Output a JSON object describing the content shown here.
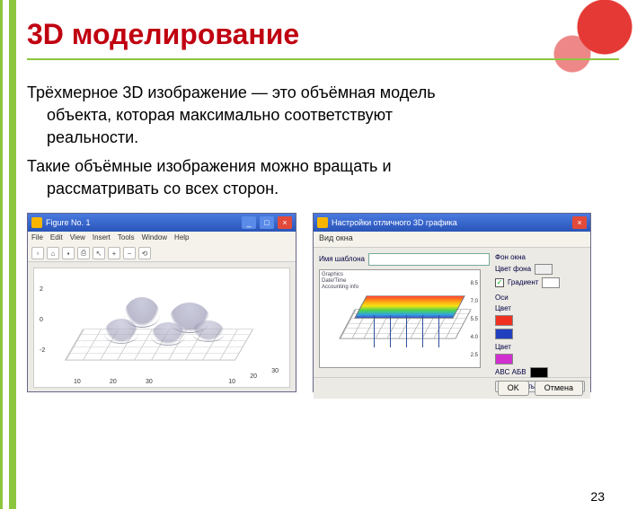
{
  "slide": {
    "title": "3D моделирование",
    "para1_line1": "Трёхмерное 3D изображение — это объёмная модель",
    "para1_line2": "объекта, которая максимально соответствуют",
    "para1_line3": "реальности.",
    "para2_line1": "Такие объёмные изображения можно вращать и",
    "para2_line2": "рассматривать со всех сторон.",
    "page_number": "23"
  },
  "win1": {
    "title": "Figure No. 1",
    "menu": [
      "File",
      "Edit",
      "View",
      "Insert",
      "Tools",
      "Window",
      "Help"
    ],
    "yticks": [
      "2",
      "0",
      "-2"
    ],
    "xticks_a": [
      "10",
      "20",
      "30"
    ],
    "xticks_b": [
      "10",
      "20",
      "30"
    ]
  },
  "win2": {
    "title": "Настройки отличного 3D графика",
    "tab": "Вид окна",
    "field_name": "Имя шаблона",
    "preview_labels": [
      "Graphics",
      "Date/Time",
      "Accounting info"
    ],
    "yticks": [
      "8.5",
      "7.0",
      "5.5",
      "4.0",
      "2.5"
    ],
    "options": {
      "gradient_label": "Градиент",
      "font_label": "Фон окна",
      "font_color_label": "Цвет фона",
      "axes_label": "Оси",
      "color_label": "Цвет",
      "abc_label": "ABC АБВ",
      "font_btn": "Настроить шрифт..."
    },
    "ok_btn": "OK",
    "cancel_btn": "Отмена"
  }
}
